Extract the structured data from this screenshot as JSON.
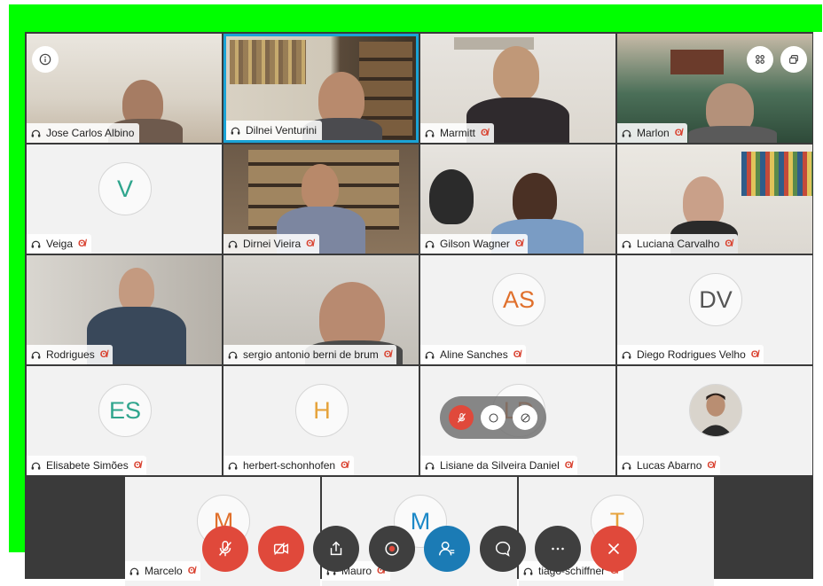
{
  "tiles": [
    {
      "name": "Jose Carlos Albino",
      "muted": false,
      "type": "video"
    },
    {
      "name": "Dilnei Venturini",
      "muted": false,
      "type": "video",
      "active": true
    },
    {
      "name": "Marmitt",
      "muted": true,
      "type": "video"
    },
    {
      "name": "Marlon",
      "muted": true,
      "type": "video"
    },
    {
      "name": "Veiga",
      "muted": true,
      "type": "avatar",
      "initials": "V",
      "color": "#2fa58d"
    },
    {
      "name": "Dirnei Vieira",
      "muted": true,
      "type": "video"
    },
    {
      "name": "Gilson Wagner",
      "muted": true,
      "type": "video"
    },
    {
      "name": "Luciana Carvalho",
      "muted": true,
      "type": "video"
    },
    {
      "name": "Rodrigues",
      "muted": true,
      "type": "video"
    },
    {
      "name": "sergio antonio berni de brum",
      "muted": true,
      "type": "video"
    },
    {
      "name": "Aline Sanches",
      "muted": true,
      "type": "avatar",
      "initials": "AS",
      "color": "#e0702c"
    },
    {
      "name": "Diego Rodrigues Velho",
      "muted": true,
      "type": "avatar",
      "initials": "DV",
      "color": "#555555"
    },
    {
      "name": "Elisabete Simões",
      "muted": true,
      "type": "avatar",
      "initials": "ES",
      "color": "#2fa58d"
    },
    {
      "name": "herbert-schonhofen",
      "muted": true,
      "type": "avatar",
      "initials": "H",
      "color": "#e6a33c"
    },
    {
      "name": "Lisiane da Silveira Daniel",
      "muted": true,
      "type": "avatar",
      "initials": "LD",
      "color": "#e0702c"
    },
    {
      "name": "Lucas Abarno",
      "muted": true,
      "type": "photo"
    },
    {
      "name": "Marcelo",
      "muted": true,
      "type": "avatar",
      "initials": "M",
      "color": "#e0702c"
    },
    {
      "name": "Mauro",
      "muted": true,
      "type": "avatar",
      "initials": "M",
      "color": "#1b88c7"
    },
    {
      "name": "tiago-schiffner",
      "muted": true,
      "type": "avatar",
      "initials": "T",
      "color": "#e6a33c"
    }
  ],
  "colors": {
    "accent": "#1aa3d6",
    "mute_red": "#e0493b",
    "highlight": "#00ff00"
  },
  "icons": {
    "info": "info-icon",
    "grid": "grid-view-icon",
    "layout": "layout-icon",
    "mute": "microphone-off-icon"
  }
}
